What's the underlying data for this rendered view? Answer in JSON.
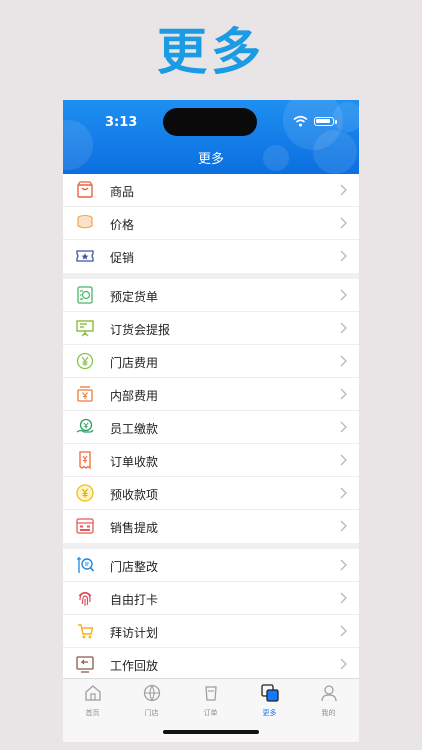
{
  "hero": {
    "title": "更多"
  },
  "status_bar": {
    "time": "3:13"
  },
  "nav": {
    "title": "更多"
  },
  "groups": [
    [
      {
        "label": "商品",
        "icon": "shopping-bag-icon"
      },
      {
        "label": "价格",
        "icon": "coin-stack-icon"
      },
      {
        "label": "促销",
        "icon": "coupon-ticket-icon"
      }
    ],
    [
      {
        "label": "预定货单",
        "icon": "reservation-sheet-icon"
      },
      {
        "label": "订货会提报",
        "icon": "presentation-board-icon"
      },
      {
        "label": "门店费用",
        "icon": "yuan-circle-icon"
      },
      {
        "label": "内部费用",
        "icon": "yuan-box-icon"
      },
      {
        "label": "员工缴款",
        "icon": "hand-yuan-icon"
      },
      {
        "label": "订单收款",
        "icon": "yuan-receipt-icon"
      },
      {
        "label": "预收款项",
        "icon": "yuan-coin-icon"
      },
      {
        "label": "销售提成",
        "icon": "commission-calculator-icon"
      }
    ],
    [
      {
        "label": "门店整改",
        "icon": "inspect-magnifier-icon"
      },
      {
        "label": "自由打卡",
        "icon": "fingerprint-icon"
      },
      {
        "label": "拜访计划",
        "icon": "visit-cart-icon"
      },
      {
        "label": "工作回放",
        "icon": "replay-icon"
      }
    ]
  ],
  "tabbar": {
    "items": [
      {
        "label": "首页",
        "icon": "home-icon"
      },
      {
        "label": "门店",
        "icon": "globe-store-icon"
      },
      {
        "label": "订单",
        "icon": "order-cup-icon"
      },
      {
        "label": "更多",
        "icon": "more-squares-icon",
        "active": true
      },
      {
        "label": "我的",
        "icon": "profile-icon"
      }
    ]
  },
  "colors": {
    "accent": "#1677ff",
    "nav_bg": "#0b6fe0",
    "hero": "#1a9be3"
  }
}
